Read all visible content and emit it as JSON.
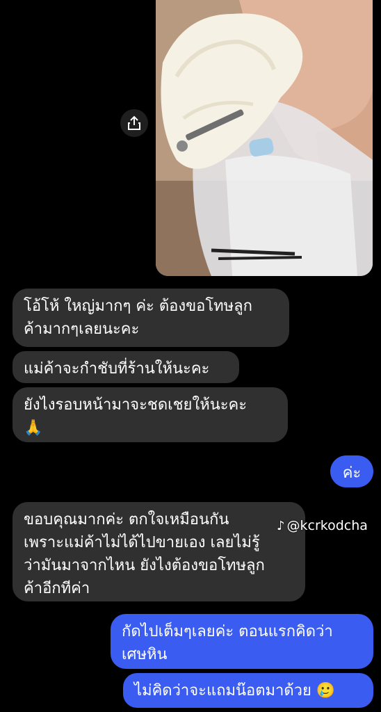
{
  "photo": {
    "alt": "hand holding sticky rice with a metal screw in a plastic bag"
  },
  "share": {
    "icon": "share-icon"
  },
  "messages": [
    {
      "side": "in",
      "text": "โอ้โห้ ใหญ่มากๆ ค่ะ ต้องขอโทษลูก\nค้ามากๆเลยนะคะ"
    },
    {
      "side": "in",
      "text": "แม่ค้าจะกำชับที่ร้านให้นะคะ"
    },
    {
      "side": "in",
      "text": "ยังไงรอบหน้ามาจะชดเชยให้นะคะ\n🙏"
    },
    {
      "side": "out",
      "text": "ค่ะ"
    },
    {
      "side": "in",
      "text": "ขอบคุณมากค่ะ ตกใจเหมือนกัน\nเพราะแม่ค้าไม่ได้ไปขายเอง เลยไม่รู้\nว่ามันมาจากไหน ยังไงต้องขอโทษลูก\nค้าอีกทีค่า"
    },
    {
      "side": "out",
      "text": "กัดไปเต็มๆเลยค่ะ ตอนแรกคิดว่า\nเศษหิน"
    },
    {
      "side": "out",
      "text": "ไม่คิดว่าจะแถมน๊อตมาด้วย 🥲"
    }
  ],
  "watermark": {
    "text": "@kcrkodcha",
    "icon": "tiktok-icon"
  },
  "colors": {
    "incoming": "#303030",
    "outgoing": "#3a5cf0",
    "background": "#000000"
  }
}
